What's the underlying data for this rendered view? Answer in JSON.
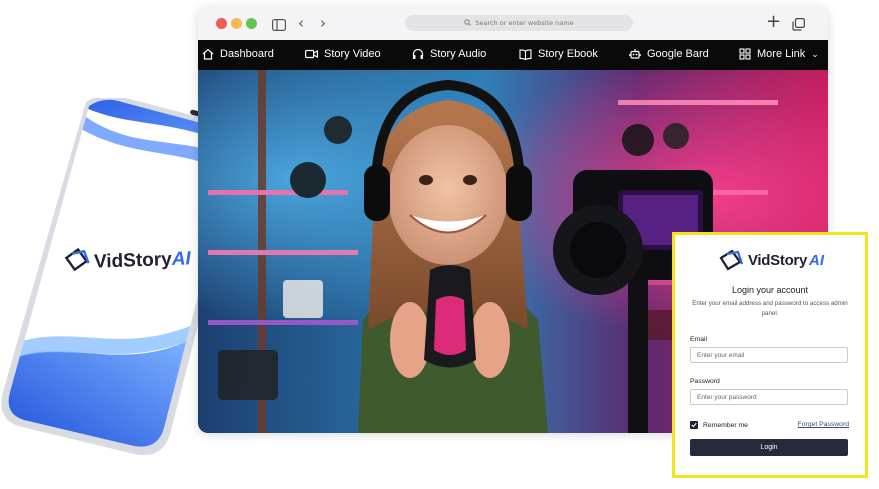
{
  "phone": {
    "brand_word": "VidStory",
    "brand_ai": "AI"
  },
  "browser": {
    "address_placeholder": "Search or enter website name",
    "nav": [
      {
        "label": "Dashboard",
        "icon": "home-icon"
      },
      {
        "label": "Story Video",
        "icon": "video-camera-icon"
      },
      {
        "label": "Story Audio",
        "icon": "headphones-icon"
      },
      {
        "label": "Story Ebook",
        "icon": "book-icon"
      },
      {
        "label": "Google Bard",
        "icon": "robot-icon"
      },
      {
        "label": "More Link",
        "icon": "grid-icon"
      }
    ]
  },
  "login": {
    "brand_word": "VidStory",
    "brand_ai": "AI",
    "title": "Login your account",
    "subtitle": "Enter your email address and password to access admin panel.",
    "email_label": "Email",
    "email_placeholder": "Enter your email",
    "password_label": "Password",
    "password_placeholder": "Enter your password",
    "remember_label": "Remember me",
    "remember_checked": true,
    "forget_label": "Forget Password",
    "login_button": "Login"
  },
  "colors": {
    "accent_blue": "#2f6bea",
    "card_border": "#f5e21c",
    "button_dark": "#262a3a"
  }
}
